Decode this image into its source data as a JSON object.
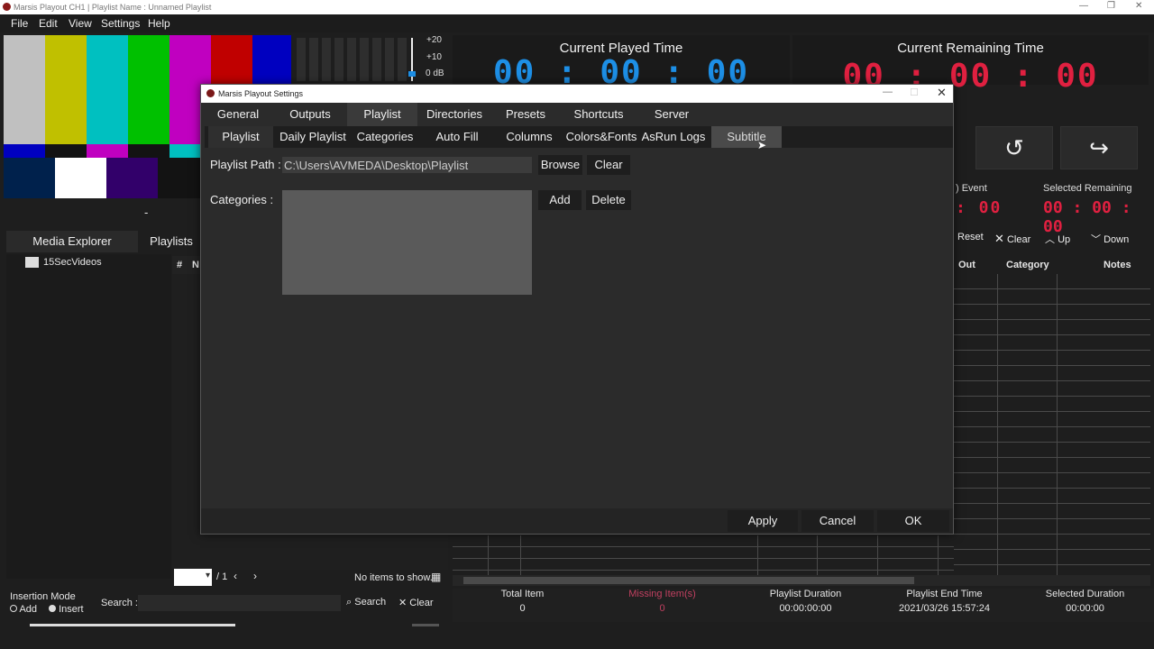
{
  "window": {
    "title": "Marsis Playout CH1 | Playlist Name : Unnamed Playlist",
    "min": "—",
    "max": "❐",
    "close": "✕"
  },
  "menu": {
    "file": "File",
    "edit": "Edit",
    "view": "View",
    "settings": "Settings",
    "help": "Help"
  },
  "preview": {
    "label": "-",
    "bar_colors": [
      "#c0c0c0",
      "#c0c000",
      "#00c0c0",
      "#00c000",
      "#c000c0",
      "#c00000",
      "#0000c0"
    ]
  },
  "meter": {
    "plus20": "+20",
    "plus10": "+10",
    "zero": "0 dB"
  },
  "played": {
    "title": "Current Played Time",
    "time": "00 : 00 : 00"
  },
  "remaining": {
    "title": "Current Remaining Time",
    "time": "00 : 00 : 00"
  },
  "controls": {
    "restart_icon": "↺",
    "skip_icon": "↪"
  },
  "event": {
    "label": ") Event",
    "time": ": 00"
  },
  "selected_remaining": {
    "label": "Selected Remaining",
    "time": "00 : 00 : 00"
  },
  "tools": {
    "reset": "Reset",
    "clear": "Clear",
    "up": "Up",
    "down": "Down"
  },
  "grid_headers": {
    "out": "Out",
    "category": "Category",
    "notes": "Notes"
  },
  "tabs": {
    "media_explorer": "Media Explorer",
    "playlists": "Playlists"
  },
  "explorer": {
    "folder": "15SecVideos"
  },
  "list_headers": {
    "num": "#",
    "n": "N"
  },
  "pager": {
    "page": "/ 1",
    "no_items": "No items to show."
  },
  "insertion": {
    "title": "Insertion Mode",
    "add": "Add",
    "insert": "Insert"
  },
  "search": {
    "label": "Search :",
    "button": "Search",
    "clear": "Clear",
    "value": ""
  },
  "stats": {
    "total_label": "Total Item",
    "total_value": "0",
    "missing_label": "Missing Item(s)",
    "missing_value": "0",
    "duration_label": "Playlist Duration",
    "duration_value": "00:00:00:00",
    "end_label": "Playlist End Time",
    "end_value": "2021/03/26 15:57:24",
    "sel_label": "Selected Duration",
    "sel_value": "00:00:00"
  },
  "dialog": {
    "title": "Marsis Playout Settings",
    "tabs": [
      "General",
      "Outputs",
      "Playlist",
      "Directories",
      "Presets",
      "Shortcuts",
      "Server"
    ],
    "subtabs": [
      "Playlist",
      "Daily Playlist",
      "Categories",
      "Auto Fill",
      "Columns",
      "Colors&Fonts",
      "AsRun Logs",
      "Subtitle"
    ],
    "playlist_path_label": "Playlist Path :",
    "playlist_path_value": "C:\\Users\\AVMEDA\\Desktop\\Playlist",
    "browse": "Browse",
    "clear": "Clear",
    "categories_label": "Categories :",
    "add": "Add",
    "delete": "Delete",
    "apply": "Apply",
    "cancel": "Cancel",
    "ok": "OK"
  }
}
